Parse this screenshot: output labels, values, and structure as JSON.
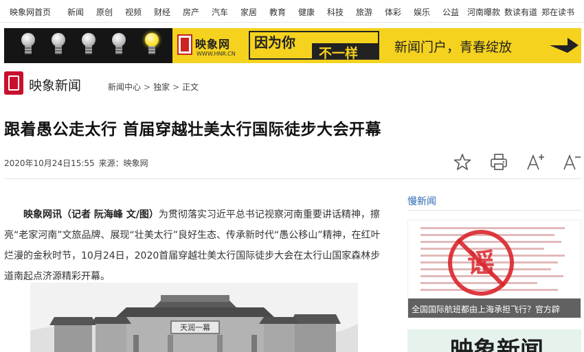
{
  "topnav": {
    "items": [
      "映象网首页",
      "新闻",
      "原创",
      "视频",
      "财经",
      "房产",
      "汽车",
      "家居",
      "教育",
      "健康",
      "科技",
      "旅游",
      "体彩",
      "娱乐",
      "公益",
      "河南曝款",
      "数读有道",
      "郑在读书"
    ]
  },
  "banner": {
    "brand": "映象网",
    "url": "WWW.HNR.CN",
    "slogan_1": "因为你",
    "slogan_2": "不一样",
    "tagline": "新闻门户，青春绽放"
  },
  "brand": {
    "name": "映象新闻"
  },
  "breadcrumb": [
    "新闻中心",
    "独家",
    "正文"
  ],
  "article": {
    "title": "跟着愚公走太行 首届穿越壮美太行国际徒步大会开幕",
    "datetime": "2020年10月24日15:55",
    "source": "来源：映象网",
    "lead": "映象网讯（记者 阮海峰 文/图）",
    "body": "为贯彻落实习近平总书记视察河南重要讲话精神，擦亮“老家河南”文旅品牌、展现“壮美太行”良好生态、传承新时代“愚公移山”精神，在红叶烂漫的金秋时节，10月24日，2020首届穿越壮美太行国际徒步大会在太行山国家森林步道南起点济源精彩开幕。",
    "photo_sign": "天润一幕"
  },
  "sidebar": {
    "title": "慢新闻",
    "card_caption": "全国国际航班都由上海承担飞行？官方辟",
    "card_stamp": "谣",
    "card2_text": "映象新闻"
  },
  "colors": {
    "accent_blue": "#2a6ab3",
    "brand_red": "#c8102e",
    "banner_yellow": "#f5d21e"
  },
  "icons": {
    "favorite": "star-icon",
    "print": "printer-icon",
    "font_up": "font-increase-icon",
    "font_down": "font-decrease-icon"
  }
}
